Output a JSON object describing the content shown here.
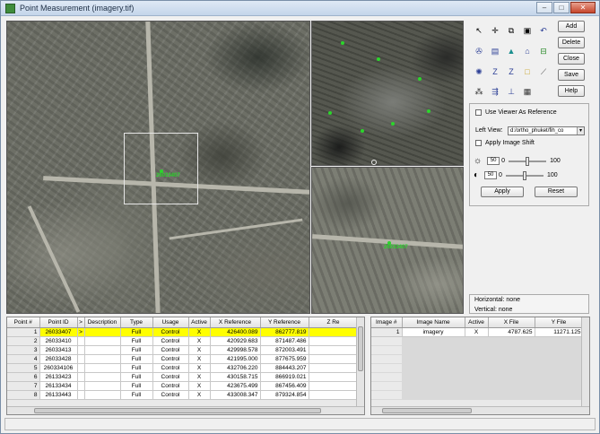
{
  "window": {
    "title": "Point Measurement (imagery.tif)"
  },
  "tools": [
    "pointer",
    "crosshair",
    "link",
    "save",
    "undo",
    "compass",
    "window",
    "triangle",
    "frame",
    "drive",
    "globe",
    "z-elevation",
    "z-range",
    "square",
    "line",
    "multi",
    "arrows",
    "height",
    "viewer"
  ],
  "side_buttons": {
    "add": "Add",
    "delete": "Delete",
    "close": "Close",
    "save": "Save",
    "help": "Help"
  },
  "options": {
    "use_viewer_label": "Use Viewer As Reference",
    "left_view_label": "Left View:",
    "left_view_value": "d:/ortho_phuket/fih_co",
    "apply_shift_label": "Apply Image Shift",
    "brightness": {
      "value": "50",
      "offset": "0",
      "max": "100"
    },
    "contrast": {
      "value": "50",
      "offset": "0",
      "max": "100"
    },
    "apply_label": "Apply",
    "reset_label": "Reset"
  },
  "info": {
    "horizontal": "Horizontal: none",
    "vertical": "Vertical: none"
  },
  "point_table": {
    "columns": [
      "Point #",
      "Point ID",
      ">",
      "Description",
      "Type",
      "Usage",
      "Active",
      "X Reference",
      "Y Reference",
      "Z Re"
    ],
    "rows": [
      {
        "num": "1",
        "id": "26033407",
        "mark": ">",
        "desc": "",
        "type": "Full",
        "usage": "Control",
        "active": "X",
        "x": "426400.089",
        "y": "862777.819",
        "sel": true
      },
      {
        "num": "2",
        "id": "26033410",
        "mark": "",
        "desc": "",
        "type": "Full",
        "usage": "Control",
        "active": "X",
        "x": "420929.683",
        "y": "871487.486",
        "sel": false
      },
      {
        "num": "3",
        "id": "26033413",
        "mark": "",
        "desc": "",
        "type": "Full",
        "usage": "Control",
        "active": "X",
        "x": "429998.578",
        "y": "872003.491",
        "sel": false
      },
      {
        "num": "4",
        "id": "26033428",
        "mark": "",
        "desc": "",
        "type": "Full",
        "usage": "Control",
        "active": "X",
        "x": "421995.000",
        "y": "877675.959",
        "sel": false
      },
      {
        "num": "5",
        "id": "260334106",
        "mark": "",
        "desc": "",
        "type": "Full",
        "usage": "Control",
        "active": "X",
        "x": "432706.220",
        "y": "884443.207",
        "sel": false
      },
      {
        "num": "6",
        "id": "26133423",
        "mark": "",
        "desc": "",
        "type": "Full",
        "usage": "Control",
        "active": "X",
        "x": "430158.715",
        "y": "866919.021",
        "sel": false
      },
      {
        "num": "7",
        "id": "26133434",
        "mark": "",
        "desc": "",
        "type": "Full",
        "usage": "Control",
        "active": "X",
        "x": "423675.499",
        "y": "867456.409",
        "sel": false
      },
      {
        "num": "8",
        "id": "26133443",
        "mark": "",
        "desc": "",
        "type": "Full",
        "usage": "Control",
        "active": "X",
        "x": "433008.347",
        "y": "879324.854",
        "sel": false
      }
    ]
  },
  "image_table": {
    "columns": [
      "Image #",
      "Image Name",
      "Active",
      "X File",
      "Y File"
    ],
    "rows": [
      {
        "num": "1",
        "name": "imagery",
        "active": "X",
        "x": "4787.625",
        "y": "11271.125"
      }
    ]
  },
  "viewer": {
    "point_label": "26033407"
  }
}
